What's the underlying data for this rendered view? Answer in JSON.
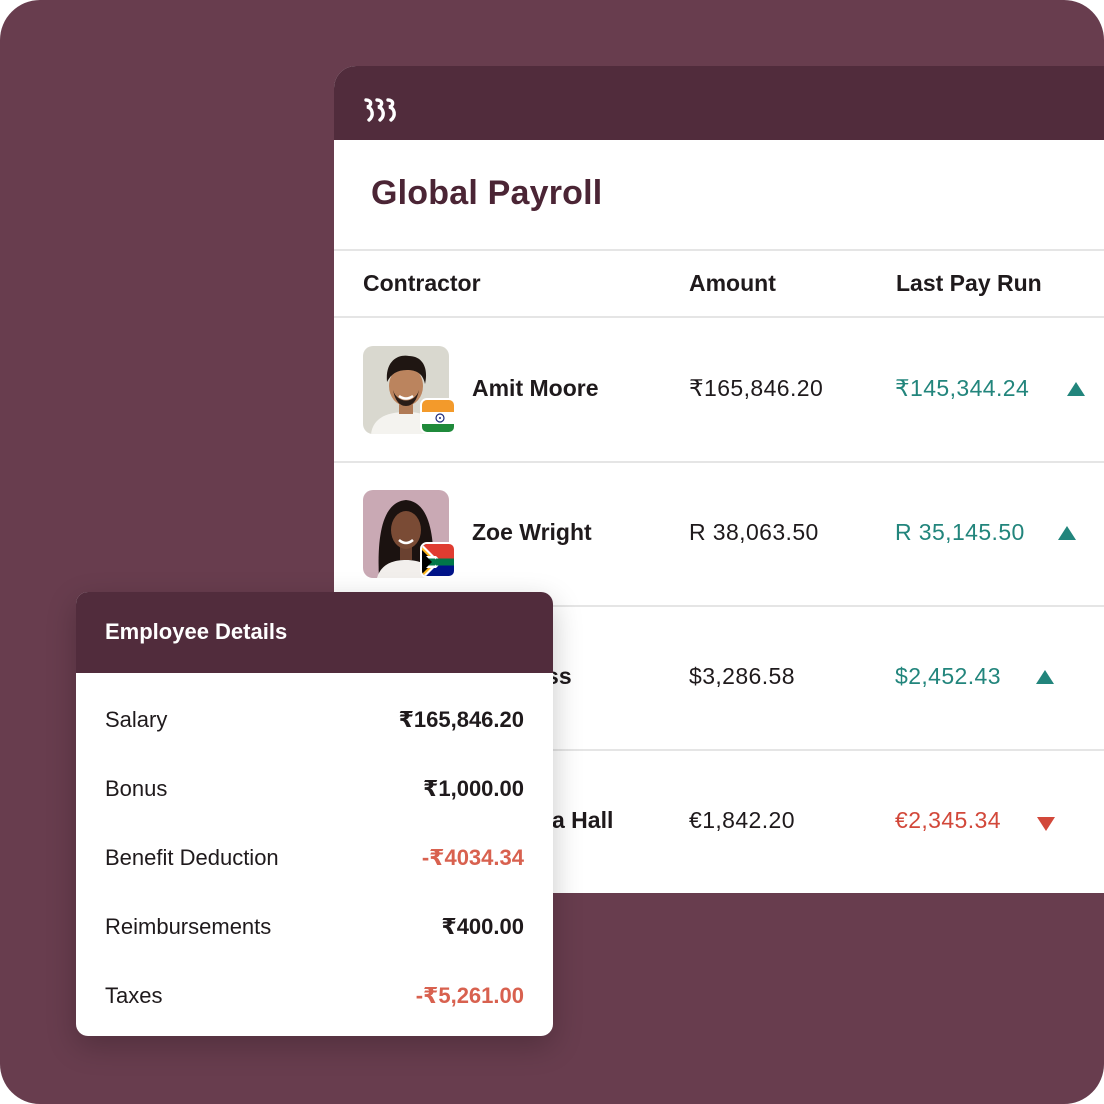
{
  "app": {
    "logo_icon": "brand-logo-icon",
    "page_title": "Global Payroll"
  },
  "table": {
    "headers": {
      "contractor": "Contractor",
      "amount": "Amount",
      "last_pay_run": "Last Pay Run"
    },
    "rows": [
      {
        "name": "Amit Moore",
        "amount": "₹165,846.20",
        "last_pay_run": "₹145,344.24",
        "trend": "up",
        "flag_icon": "india-flag-icon",
        "avatar": "avatar-amit-moore"
      },
      {
        "name": "Zoe Wright",
        "amount": "R 38,063.50",
        "last_pay_run": "R 35,145.50",
        "trend": "up",
        "flag_icon": "south-africa-flag-icon",
        "avatar": "avatar-zoe-wright"
      },
      {
        "name": "oss",
        "amount": "$3,286.58",
        "last_pay_run": "$2,452.43",
        "trend": "up"
      },
      {
        "name": "a Hall",
        "amount": "€1,842.20",
        "last_pay_run": "€2,345.34",
        "trend": "down"
      }
    ]
  },
  "employee_details": {
    "title": "Employee Details",
    "items": [
      {
        "label": "Salary",
        "value": "₹165,846.20",
        "negative": false
      },
      {
        "label": "Bonus",
        "value": "₹1,000.00",
        "negative": false
      },
      {
        "label": "Benefit Deduction",
        "value": "-₹4034.34",
        "negative": true
      },
      {
        "label": "Reimbursements",
        "value": "₹400.00",
        "negative": false
      },
      {
        "label": "Taxes",
        "value": "-₹5,261.00",
        "negative": true
      }
    ]
  },
  "colors": {
    "background": "#683d4e",
    "header_bar": "#512c3c",
    "title_text": "#4b2535",
    "positive": "#22857c",
    "negative": "#d2483a",
    "deduction": "#d8614f"
  }
}
